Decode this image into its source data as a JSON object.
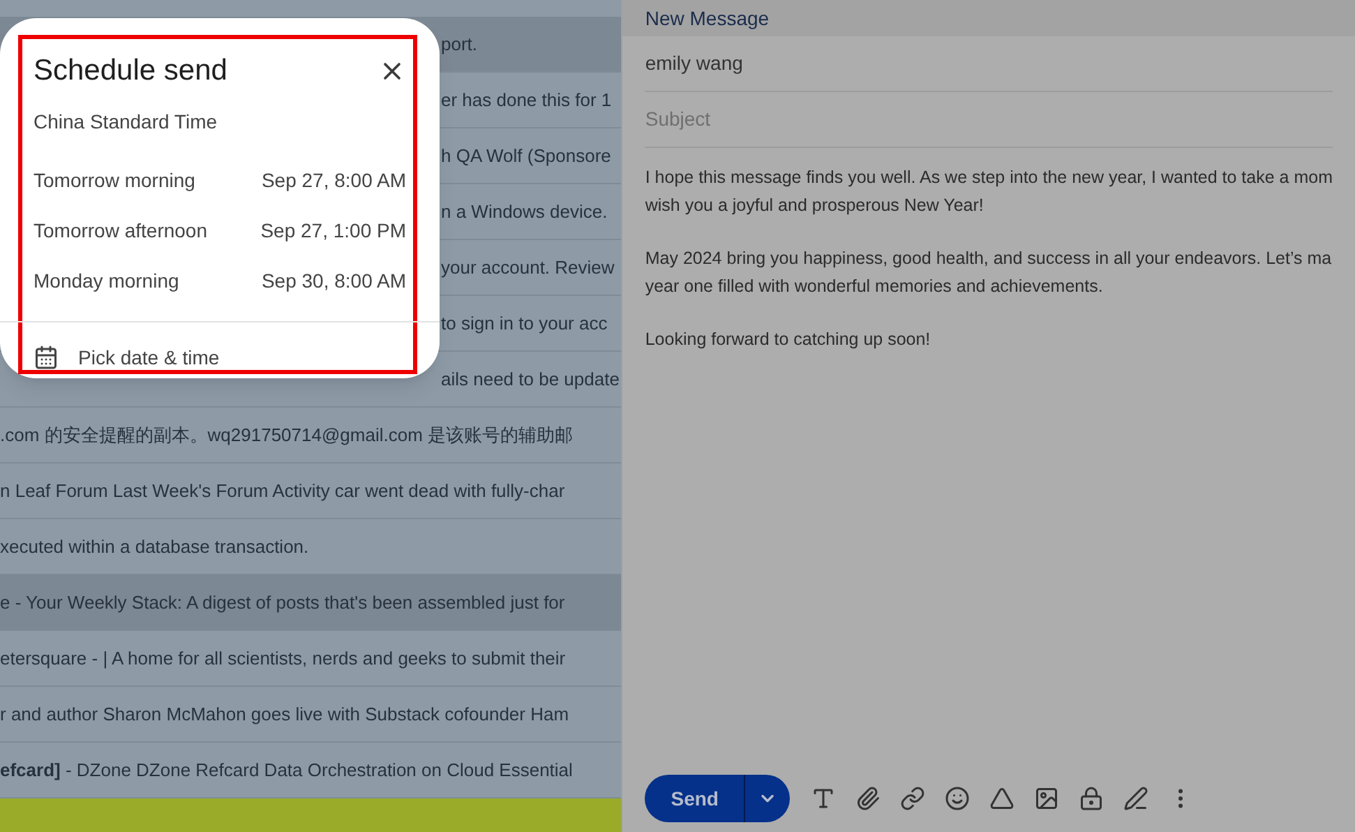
{
  "email_rows": [
    {
      "text": "port.",
      "read": true,
      "under_dialog": true
    },
    {
      "text": "er has done this for 1",
      "read": false,
      "under_dialog": true
    },
    {
      "text": "h QA Wolf (Sponsore",
      "read": false,
      "under_dialog": true
    },
    {
      "text": "n a Windows device.",
      "read": false,
      "under_dialog": true
    },
    {
      "text": "your account. Review",
      "read": false,
      "under_dialog": true
    },
    {
      "text": "to sign in to your acc",
      "read": false,
      "under_dialog": true
    },
    {
      "text": "ails need to be update",
      "read": false,
      "under_dialog": true
    },
    {
      "text": ".com 的安全提醒的副本。wq291750714@gmail.com 是该账号的辅助邮",
      "read": false,
      "under_dialog": false
    },
    {
      "text": "n Leaf Forum Last Week's Forum Activity car went dead with fully-char",
      "read": false,
      "under_dialog": false
    },
    {
      "text": "xecuted within a database transaction.",
      "read": false,
      "under_dialog": false
    },
    {
      "text": "e - Your Weekly Stack: A digest of posts that's been assembled just for",
      "read": true,
      "under_dialog": false
    },
    {
      "text": "etersquare - | A home for all scientists, nerds and geeks to submit their",
      "read": false,
      "under_dialog": false
    },
    {
      "text": "r and author Sharon McMahon goes live with Substack cofounder Ham",
      "read": false,
      "under_dialog": false
    },
    {
      "text": "**efcard]** - DZone DZone Refcard Data Orchestration on Cloud Essential",
      "read": false,
      "under_dialog": false
    }
  ],
  "schedule_dialog": {
    "title": "Schedule send",
    "timezone": "China Standard Time",
    "options": [
      {
        "label": "Tomorrow morning",
        "time": "Sep 27, 8:00 AM"
      },
      {
        "label": "Tomorrow afternoon",
        "time": "Sep 27, 1:00 PM"
      },
      {
        "label": "Monday morning",
        "time": "Sep 30, 8:00 AM"
      }
    ],
    "pick": "Pick date & time"
  },
  "compose": {
    "title": "New Message",
    "to": "emily wang",
    "subject_placeholder": "Subject",
    "body_paragraphs": [
      [
        "I hope this message finds you well. As we step into the new year, I wanted to take a mom",
        "wish you a joyful and prosperous New Year!"
      ],
      [
        "May 2024 bring you happiness, good health, and success in all your endeavors. Let’s ma",
        "year one filled with wonderful memories and achievements."
      ],
      [
        "Looking forward to catching up soon!"
      ]
    ],
    "send": "Send"
  }
}
